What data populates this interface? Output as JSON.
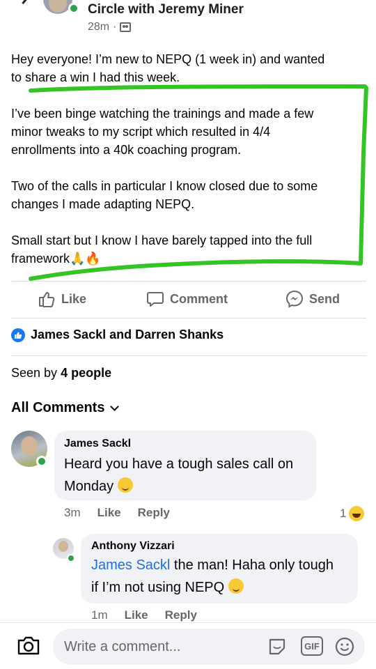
{
  "header": {
    "title": "Circle with Jeremy Miner",
    "time": "28m",
    "separator": "·"
  },
  "post": {
    "paragraphs": [
      "Hey everyone! I’m new to NEPQ (1 week in) and wanted\nto share a win I had this week.",
      "I’ve been binge watching the trainings and made a few\nminor tweaks to my script which resulted in 4/4\nenrollments into a 40k coaching program.",
      "Two of the calls in particular I know closed due to some\nchanges I made adapting NEPQ.",
      "Small start but I know I have barely tapped into the full\nframework🙏🔥"
    ],
    "highlight_color": "#34c426"
  },
  "actions": {
    "like": "Like",
    "comment": "Comment",
    "send": "Send"
  },
  "reactions": {
    "names": "James Sackl and Darren Shanks",
    "seen_prefix": "Seen by",
    "seen_count": "4 people"
  },
  "comments_header": "All Comments",
  "comments": [
    {
      "author": "James Sackl",
      "text": "Heard you have a tough sales call on\nMonday",
      "emoji": "wink-emoji",
      "time": "3m",
      "like": "Like",
      "reply": "Reply",
      "reaction_count": "1"
    },
    {
      "author": "Anthony Vizzari",
      "mention": "James Sackl",
      "text": " the man! Haha only tough\nif I’m not using NEPQ",
      "emoji": "wink-emoji",
      "time": "1m",
      "like": "Like",
      "reply": "Reply"
    }
  ],
  "composer": {
    "placeholder": "Write a comment...",
    "gif_label": "GIF"
  },
  "colors": {
    "link": "#216fdb",
    "brand_blue": "#1877f2",
    "online": "#31a24c"
  }
}
